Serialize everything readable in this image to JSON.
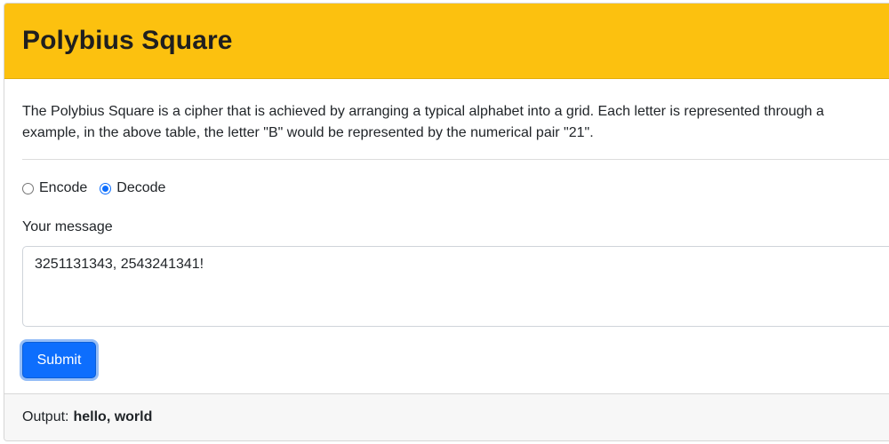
{
  "header": {
    "title": "Polybius Square"
  },
  "intro": {
    "line1": "The Polybius Square is a cipher that is achieved by arranging a typical alphabet into a grid. Each letter is represented through a",
    "line2": "example, in the above table, the letter \"B\" would be represented by the numerical pair \"21\"."
  },
  "mode": {
    "options": [
      {
        "label": "Encode",
        "checked": false
      },
      {
        "label": "Decode",
        "checked": true
      }
    ]
  },
  "message": {
    "label": "Your message",
    "value": "3251131343, 2543241341!"
  },
  "submit": {
    "label": "Submit"
  },
  "output": {
    "label": "Output:",
    "value": "hello, world"
  },
  "colors": {
    "header_bg": "#fcc10f",
    "primary": "#0d6efd",
    "footer_bg": "#f7f7f7"
  }
}
